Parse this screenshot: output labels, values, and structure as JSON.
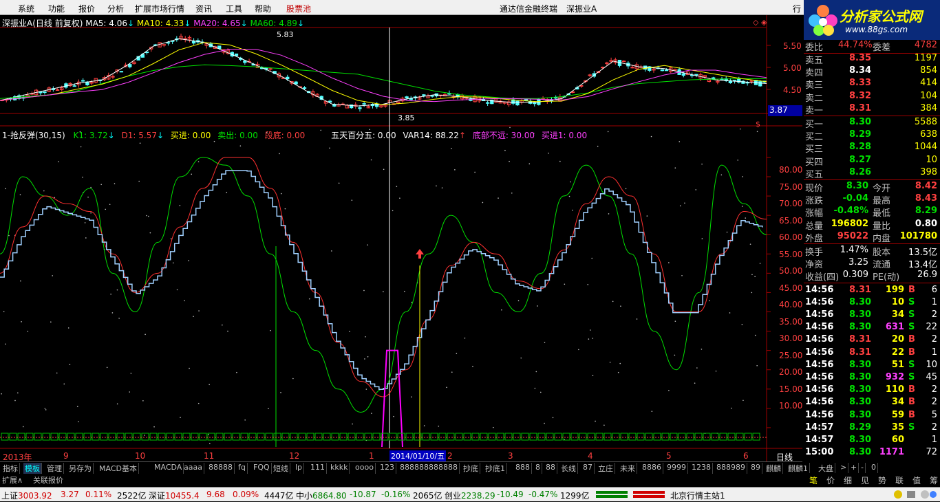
{
  "menu": {
    "items": [
      "系统",
      "功能",
      "报价",
      "分析",
      "扩展市场行情",
      "资讯",
      "工具",
      "帮助",
      "股票池"
    ],
    "window_title": "通达信金融终端",
    "stock_title": "深振业A",
    "right_item": "行"
  },
  "logo": {
    "name": "分析家公式网",
    "url": "www.88gs.com"
  },
  "chart": {
    "header_main": {
      "title": "深振业A(日线 前复权)",
      "ma5": "MA5: 4.06",
      "ma10": "MA10: 4.33",
      "ma20": "MA20: 4.65",
      "ma60": "MA60: 4.89"
    },
    "price_labels": [
      "5.50",
      "5.00",
      "4.50"
    ],
    "current_price_box": "3.87",
    "high_label": "5.83",
    "low_label": "3.85",
    "header_ind": {
      "name": "1-抢反弹(30,15)",
      "k1": "K1: 3.72",
      "d1": "D1: 5.57",
      "buy": "买进: 0.00",
      "sell": "卖出: 0.00",
      "duan": "段底: 0.00",
      "wu": "五天百分五: 0.00",
      "var14": "VAR14: 88.22",
      "dibu": "底部不远: 30.00",
      "buy1": "买进1: 0.00"
    },
    "ind_labels": [
      "80.00",
      "75.00",
      "70.00",
      "65.00",
      "60.00",
      "55.00",
      "50.00",
      "45.00",
      "40.00",
      "35.00",
      "30.00",
      "25.00",
      "20.00",
      "15.00",
      "10.00"
    ],
    "x_labels": [
      "2013年",
      "9",
      "10",
      "11",
      "12",
      "1",
      "2",
      "3",
      "4",
      "5",
      "6"
    ],
    "cursor_date": "2014/01/10/五",
    "period_label": "日线"
  },
  "chart_data": {
    "type": "line",
    "title": "深振业A(日线 前复权)",
    "price_ylim": [
      3.7,
      6.0
    ],
    "price_points_note": "candlestick daily prices",
    "price_series": [
      {
        "name": "MA5",
        "values": [
          4.05,
          4.2,
          4.35,
          4.5,
          4.6,
          5.0,
          5.5,
          5.7,
          5.6,
          5.3,
          5.0,
          4.7,
          4.3,
          3.95,
          3.9,
          3.95,
          4.1,
          4.2,
          4.15,
          4.05,
          4.0,
          4.0,
          4.1,
          4.6,
          5.1,
          4.95,
          4.9,
          4.75,
          4.6,
          4.55,
          4.5
        ]
      },
      {
        "name": "MA60",
        "values": [
          4.1,
          4.15,
          4.2,
          4.3,
          4.5,
          4.7,
          4.85,
          4.95,
          5.0,
          4.98,
          4.95,
          4.9,
          4.85,
          4.8,
          4.75,
          4.6,
          4.45,
          4.3,
          4.2,
          4.15,
          4.1,
          4.1,
          4.15,
          4.25,
          4.4,
          4.5,
          4.55,
          4.6,
          4.62,
          4.63,
          4.63
        ]
      }
    ],
    "ind_ylim": [
      5,
      88
    ],
    "ind_series": [
      {
        "name": "K1",
        "values": [
          55,
          75,
          70,
          65,
          72,
          50,
          40,
          58,
          75,
          80,
          78,
          70,
          55,
          40,
          30,
          20,
          14,
          20,
          40,
          55,
          65,
          58,
          45,
          40,
          50,
          70,
          78,
          70,
          55,
          35,
          25,
          45,
          78,
          68,
          60
        ]
      },
      {
        "name": "D1",
        "values": [
          50,
          62,
          70,
          68,
          66,
          55,
          45,
          50,
          62,
          72,
          80,
          80,
          72,
          58,
          45,
          32,
          22,
          18,
          25,
          38,
          52,
          58,
          55,
          48,
          46,
          56,
          68,
          75,
          70,
          55,
          40,
          40,
          55,
          66,
          64
        ]
      }
    ]
  },
  "quote": {
    "weibi": {
      "label": "委比",
      "value": "44.74%",
      "label2": "委差",
      "value2": "4782"
    },
    "asks": [
      {
        "label": "卖五",
        "price": "8.35",
        "vol": "1197"
      },
      {
        "label": "卖四",
        "price": "8.34",
        "vol": "854"
      },
      {
        "label": "卖三",
        "price": "8.33",
        "vol": "414"
      },
      {
        "label": "卖二",
        "price": "8.32",
        "vol": "104"
      },
      {
        "label": "卖一",
        "price": "8.31",
        "vol": "384"
      }
    ],
    "bids": [
      {
        "label": "买一",
        "price": "8.30",
        "vol": "5588"
      },
      {
        "label": "买二",
        "price": "8.29",
        "vol": "638"
      },
      {
        "label": "买三",
        "price": "8.28",
        "vol": "1044"
      },
      {
        "label": "买四",
        "price": "8.27",
        "vol": "10"
      },
      {
        "label": "买五",
        "price": "8.26",
        "vol": "398"
      }
    ],
    "stats": [
      {
        "l1": "现价",
        "v1": "8.30",
        "l2": "今开",
        "v2": "8.42"
      },
      {
        "l1": "涨跌",
        "v1": "-0.04",
        "l2": "最高",
        "v2": "8.43"
      },
      {
        "l1": "涨幅",
        "v1": "-0.48%",
        "l2": "最低",
        "v2": "8.29"
      },
      {
        "l1": "总量",
        "v1": "196802",
        "l2": "量比",
        "v2": "0.80"
      },
      {
        "l1": "外盘",
        "v1": "95022",
        "l2": "内盘",
        "v2": "101780"
      }
    ],
    "stats2": [
      {
        "l1": "换手",
        "v1": "1.47%",
        "l2": "股本",
        "v2": "13.5亿"
      },
      {
        "l1": "净资",
        "v1": "3.25",
        "l2": "流通",
        "v2": "13.4亿"
      },
      {
        "l1": "收益(四)",
        "v1": "0.309",
        "l2": "PE(动)",
        "v2": "26.9"
      }
    ],
    "ticks": [
      {
        "time": "14:56",
        "price": "8.31",
        "vol": "199",
        "bs": "B",
        "n": "6"
      },
      {
        "time": "14:56",
        "price": "8.30",
        "vol": "10",
        "bs": "S",
        "n": "1"
      },
      {
        "time": "14:56",
        "price": "8.30",
        "vol": "34",
        "bs": "S",
        "n": "2"
      },
      {
        "time": "14:56",
        "price": "8.30",
        "vol": "631",
        "bs": "S",
        "n": "22"
      },
      {
        "time": "14:56",
        "price": "8.31",
        "vol": "20",
        "bs": "B",
        "n": "2"
      },
      {
        "time": "14:56",
        "price": "8.31",
        "vol": "22",
        "bs": "B",
        "n": "1"
      },
      {
        "time": "14:56",
        "price": "8.30",
        "vol": "51",
        "bs": "S",
        "n": "10"
      },
      {
        "time": "14:56",
        "price": "8.30",
        "vol": "932",
        "bs": "S",
        "n": "45"
      },
      {
        "time": "14:56",
        "price": "8.30",
        "vol": "110",
        "bs": "B",
        "n": "2"
      },
      {
        "time": "14:56",
        "price": "8.30",
        "vol": "34",
        "bs": "B",
        "n": "2"
      },
      {
        "time": "14:56",
        "price": "8.30",
        "vol": "59",
        "bs": "B",
        "n": "5"
      },
      {
        "time": "14:57",
        "price": "8.29",
        "vol": "35",
        "bs": "S",
        "n": "2"
      },
      {
        "time": "14:57",
        "price": "8.30",
        "vol": "60",
        "bs": "",
        "n": "1"
      },
      {
        "time": "15:00",
        "price": "8.30",
        "vol": "1171",
        "bs": "",
        "n": "72"
      }
    ]
  },
  "tabs1": [
    "指标",
    "模板",
    "管理",
    "另存为",
    "MACD基本",
    "MACDA",
    "aaaa",
    "88888",
    "fq",
    "FQQ",
    "短线",
    "lp",
    "111",
    "kkkk",
    "oooo",
    "123",
    "888888888888",
    "抄底",
    "抄底1",
    "888",
    "8",
    "88",
    "长线",
    "87",
    "立庄",
    "未来",
    "8886",
    "9999",
    "1238",
    "888989",
    "89",
    "麒麟",
    "麒麟1",
    "大盘",
    ">",
    "+",
    "-",
    "0"
  ],
  "tabs2": [
    "扩展∧",
    "关联报价"
  ],
  "rtabs": [
    "笔",
    "价",
    "细",
    "见",
    "势",
    "联",
    "值",
    "筹"
  ],
  "status": {
    "sh_label": "上证",
    "sh_val": "3003.92",
    "sh_chg": "3.27",
    "sh_pct": "0.11%",
    "sh_amt": "2522亿",
    "sz_label": "深证",
    "sz_val": "10455.4",
    "sz_chg": "9.68",
    "sz_pct": "0.09%",
    "sz_amt": "4447亿",
    "zx_label": "中小",
    "zx_val": "6864.80",
    "zx_chg": "-10.87",
    "zx_pct": "-0.16%",
    "zx_amt": "2065亿",
    "cy_label": "创业",
    "cy_val": "2238.29",
    "cy_chg": "-10.49",
    "cy_pct": "-0.47%",
    "cy_amt": "1299亿",
    "server": "北京行情主站1"
  }
}
